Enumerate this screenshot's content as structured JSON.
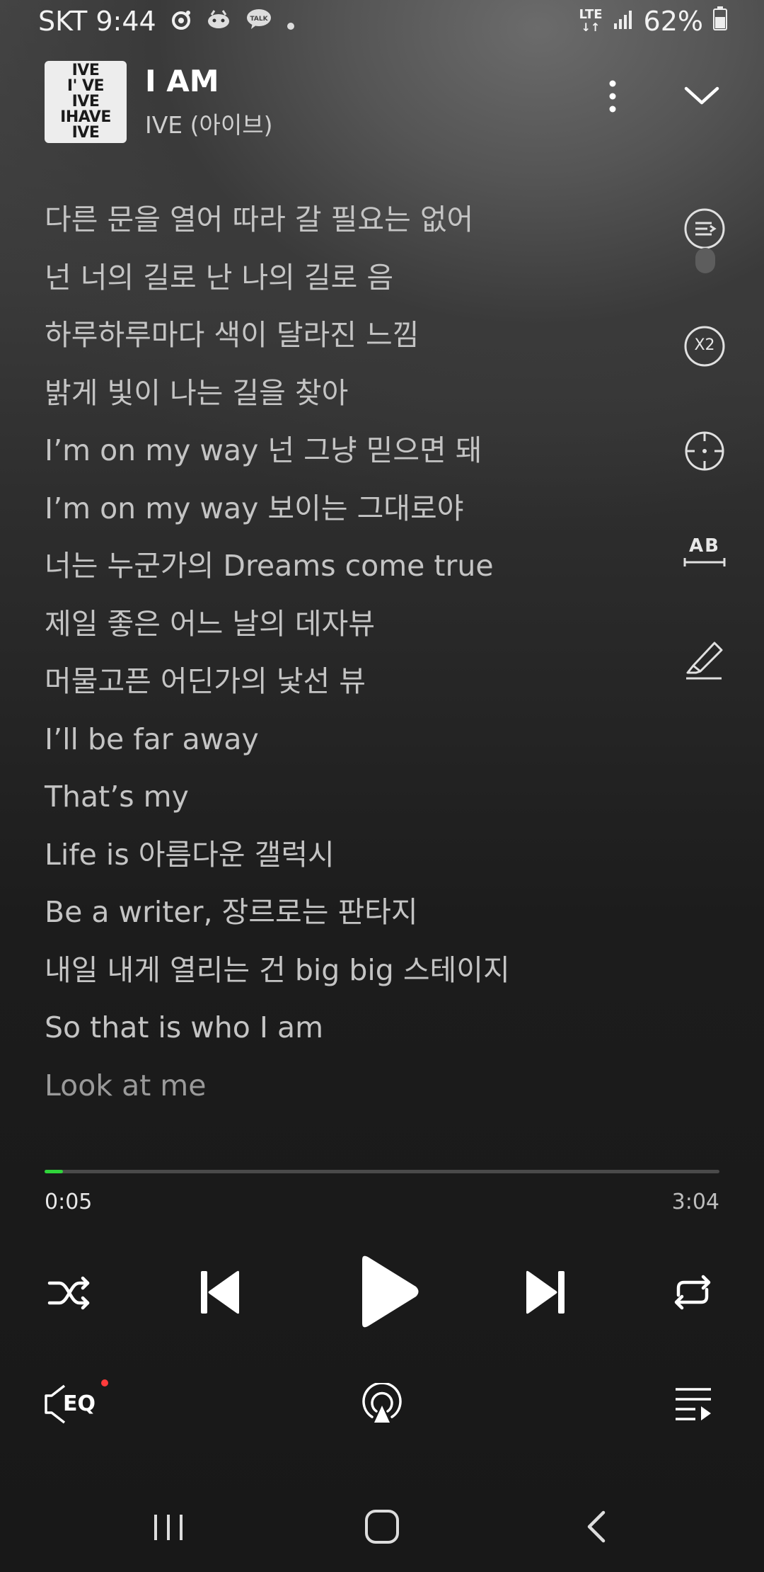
{
  "status_bar": {
    "carrier_time": "SKT 9:44",
    "network": "LTE",
    "battery": "62%",
    "icons": [
      "record-icon",
      "game-icon",
      "talk-icon",
      "dot-icon"
    ]
  },
  "header": {
    "album_art_lines": [
      "IVE",
      "I' VE",
      "IVE",
      "IHAVE",
      "IVE"
    ],
    "title": "I AM",
    "artist": "IVE (아이브)"
  },
  "lyrics": [
    "다른 문을 열어 따라 갈 필요는 없어",
    "넌 너의 길로 난 나의 길로 음",
    "하루하루마다 색이 달라진 느낌",
    "밝게 빛이 나는 길을 찾아",
    "I’m on my way 넌 그냥 믿으면 돼",
    "I’m on my way 보이는 그대로야",
    "너는 누군가의 Dreams come true",
    "제일 좋은 어느 날의 데자뷰",
    "머물고픈 어딘가의 낯선 뷰",
    "I’ll be far away",
    "That’s my",
    "Life is 아름다운 갤럭시",
    "Be a writer, 장르로는 판타지",
    "내일 내게 열리는 건 big big 스테이지",
    "So that is who I am",
    "Look at me"
  ],
  "side_tools": {
    "speed_label": "X2",
    "ab_label": "AB"
  },
  "player": {
    "progress_fraction": 0.027,
    "current_time": "0:05",
    "total_time": "3:04",
    "accent_color": "#2fd43a"
  },
  "bottom": {
    "eq_label": "EQ",
    "eq_badge_color": "#ff3b3b"
  }
}
